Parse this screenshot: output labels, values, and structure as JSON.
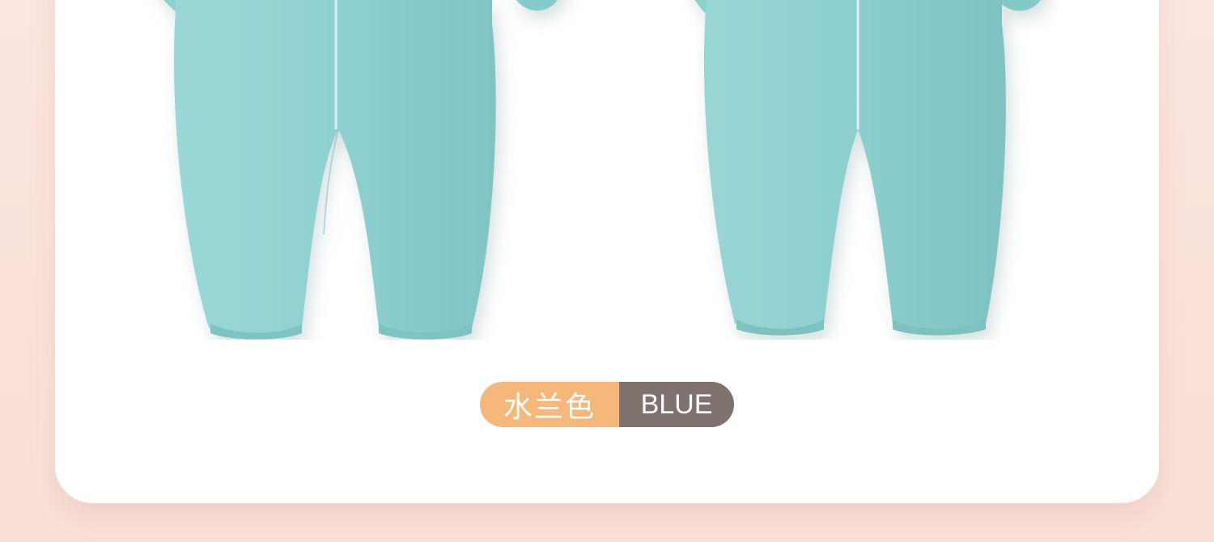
{
  "color_badge": {
    "name_cn": "水兰色",
    "name_en": "BLUE"
  },
  "products": [
    {
      "label": "front-view",
      "color": "#8fd1d0"
    },
    {
      "label": "back-view",
      "color": "#8bcdcc"
    }
  ],
  "colors": {
    "page_background": "#fbe6e0",
    "card_background": "#ffffff",
    "badge_left": "#f6b77a",
    "badge_right": "#7f716d",
    "garment": "#8fd1d0"
  }
}
